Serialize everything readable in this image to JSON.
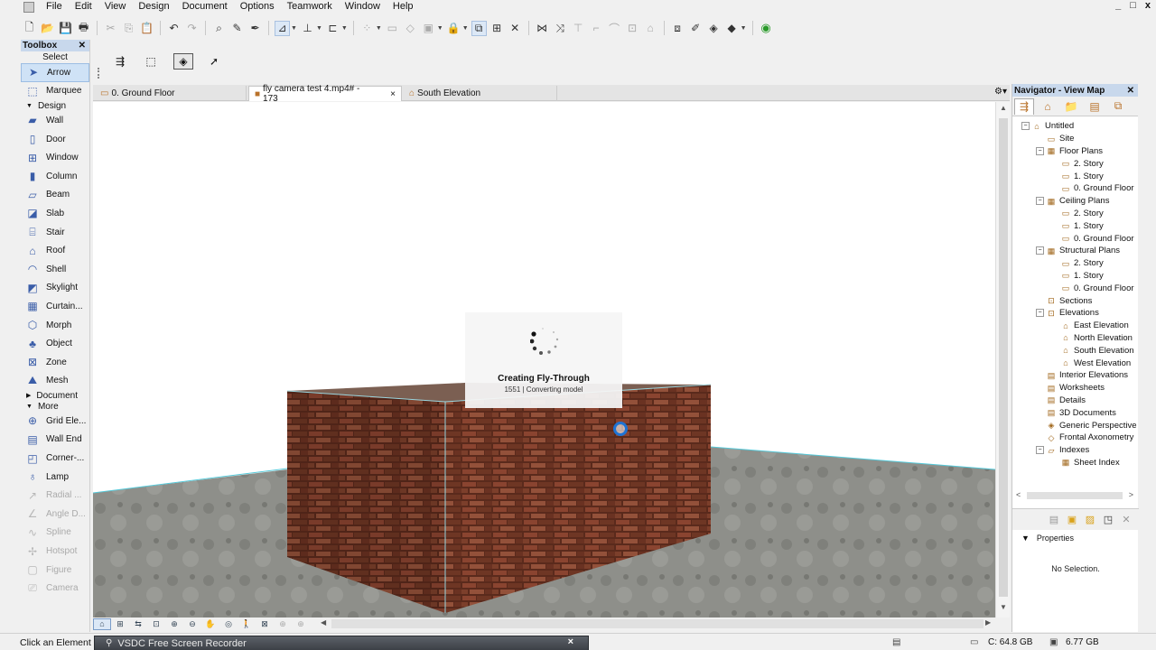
{
  "menu": [
    "File",
    "Edit",
    "View",
    "Design",
    "Document",
    "Options",
    "Teamwork",
    "Window",
    "Help"
  ],
  "window_controls": [
    "_",
    "□",
    "x"
  ],
  "toolbox": {
    "title": "Toolbox",
    "select_label": "Select",
    "select_tools": [
      "Arrow",
      "Marquee"
    ],
    "design_label": "Design",
    "design_tools": [
      "Wall",
      "Door",
      "Window",
      "Column",
      "Beam",
      "Slab",
      "Stair",
      "Roof",
      "Shell",
      "Skylight",
      "Curtain...",
      "Morph",
      "Object",
      "Zone",
      "Mesh"
    ],
    "document_label": "Document",
    "more_label": "More",
    "more_tools": [
      "Grid Ele...",
      "Wall End",
      "Corner-...",
      "Lamp",
      "Radial ...",
      "Angle D...",
      "Spline",
      "Hotspot",
      "Figure",
      "Camera"
    ]
  },
  "tabs": [
    {
      "label": "0. Ground Floor",
      "close": ""
    },
    {
      "label": "fly camera test 4.mp4# - 173",
      "close": "×"
    },
    {
      "label": "South Elevation",
      "close": ""
    }
  ],
  "progress": {
    "title": "Creating Fly-Through",
    "subtitle": "1551 | Converting model"
  },
  "navigator": {
    "title": "Navigator - View Map",
    "tree": [
      {
        "label": "Untitled",
        "level": 0,
        "expander": "−",
        "icon": "project"
      },
      {
        "label": "Site",
        "level": 1,
        "expander": "",
        "icon": "folder"
      },
      {
        "label": "Floor Plans",
        "level": 1,
        "expander": "−",
        "icon": "plan"
      },
      {
        "label": "2. Story",
        "level": 2,
        "expander": "",
        "icon": "folder"
      },
      {
        "label": "1. Story",
        "level": 2,
        "expander": "",
        "icon": "folder"
      },
      {
        "label": "0. Ground Floor",
        "level": 2,
        "expander": "",
        "icon": "folder"
      },
      {
        "label": "Ceiling Plans",
        "level": 1,
        "expander": "−",
        "icon": "plan"
      },
      {
        "label": "2. Story",
        "level": 2,
        "expander": "",
        "icon": "folder"
      },
      {
        "label": "1. Story",
        "level": 2,
        "expander": "",
        "icon": "folder"
      },
      {
        "label": "0. Ground Floor",
        "level": 2,
        "expander": "",
        "icon": "folder"
      },
      {
        "label": "Structural Plans",
        "level": 1,
        "expander": "−",
        "icon": "plan"
      },
      {
        "label": "2. Story",
        "level": 2,
        "expander": "",
        "icon": "folder"
      },
      {
        "label": "1. Story",
        "level": 2,
        "expander": "",
        "icon": "folder"
      },
      {
        "label": "0. Ground Floor",
        "level": 2,
        "expander": "",
        "icon": "folder"
      },
      {
        "label": "Sections",
        "level": 1,
        "expander": "",
        "icon": "section"
      },
      {
        "label": "Elevations",
        "level": 1,
        "expander": "−",
        "icon": "section"
      },
      {
        "label": "East Elevation",
        "level": 2,
        "expander": "",
        "icon": "house"
      },
      {
        "label": "North Elevation",
        "level": 2,
        "expander": "",
        "icon": "house"
      },
      {
        "label": "South Elevation",
        "level": 2,
        "expander": "",
        "icon": "house"
      },
      {
        "label": "West Elevation",
        "level": 2,
        "expander": "",
        "icon": "house"
      },
      {
        "label": "Interior Elevations",
        "level": 1,
        "expander": "",
        "icon": "doc"
      },
      {
        "label": "Worksheets",
        "level": 1,
        "expander": "",
        "icon": "doc"
      },
      {
        "label": "Details",
        "level": 1,
        "expander": "",
        "icon": "doc"
      },
      {
        "label": "3D Documents",
        "level": 1,
        "expander": "",
        "icon": "doc"
      },
      {
        "label": "Generic Perspective",
        "level": 1,
        "expander": "",
        "icon": "camera"
      },
      {
        "label": "Frontal Axonometry",
        "level": 1,
        "expander": "",
        "icon": "cube"
      },
      {
        "label": "Indexes",
        "level": 1,
        "expander": "−",
        "icon": "openfolder"
      },
      {
        "label": "Sheet Index",
        "level": 2,
        "expander": "",
        "icon": "grid"
      }
    ],
    "properties_label": "Properties",
    "no_selection": "No Selection."
  },
  "status": {
    "message": "Click an Element o",
    "recorder_title": "VSDC Free Screen Recorder",
    "recorder_close": "×",
    "disk_c": "C: 64.8 GB",
    "memory": "6.77 GB"
  },
  "colors": {
    "panel_header": "#c8d8ec",
    "selection": "#cfe2f6",
    "brick": "#7a3a26",
    "floor": "#8a8b86",
    "spinner_cursor": "#1e73d4"
  }
}
